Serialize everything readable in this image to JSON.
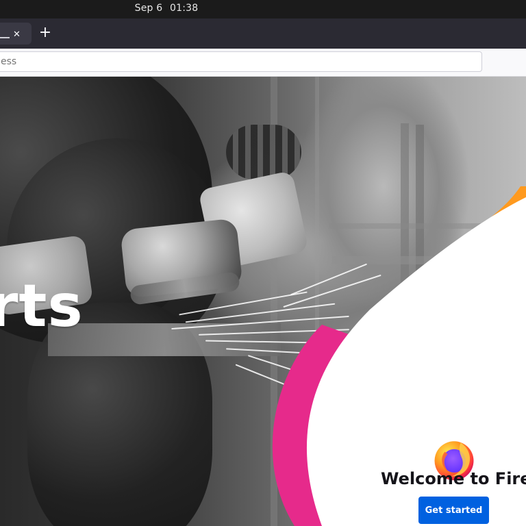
{
  "system": {
    "date": "Sep 6",
    "time": "01:38"
  },
  "browser": {
    "tab_close_icon": "close-icon",
    "new_tab_icon": "plus-icon",
    "url_placeholder": "ess"
  },
  "page": {
    "hero_text": "rts",
    "welcome_title": "Welcome to Firefox",
    "get_started_label": "Get started"
  },
  "colors": {
    "topbar": "#1b1b1b",
    "tabstrip": "#2b2a33",
    "navbar": "#f9f9fb",
    "primary_button": "#0061e0",
    "accent_pink": "#e62a8b",
    "accent_orange": "#ff9a1f"
  }
}
